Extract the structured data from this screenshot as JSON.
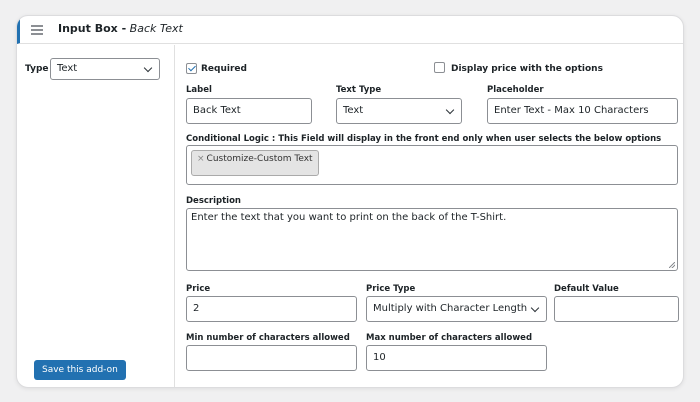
{
  "header": {
    "title_bold": "Input Box -",
    "title_italic": "Back Text"
  },
  "sidebar": {
    "type_label": "Type",
    "type_value": "Text",
    "save_label": "Save this add-on"
  },
  "form": {
    "required_label": "Required",
    "required_checked": true,
    "display_price_label": "Display price with the options",
    "display_price_checked": false,
    "label_label": "Label",
    "label_value": "Back Text",
    "text_type_label": "Text Type",
    "text_type_value": "Text",
    "placeholder_label": "Placeholder",
    "placeholder_value": "Enter Text - Max 10 Characters",
    "conditional_label": "Conditional Logic : This Field will display in the front end only when user selects the below options",
    "conditional_tag_x": "×",
    "conditional_tag": "Customize-Custom Text",
    "description_label": "Description",
    "description_value": "Enter the text that you want to print on the back of the T-Shirt.",
    "price_label": "Price",
    "price_value": "2",
    "price_type_label": "Price Type",
    "price_type_value": "Multiply with Character Length",
    "default_value_label": "Default Value",
    "default_value": "",
    "min_chars_label": "Min number of characters allowed",
    "min_chars_value": "",
    "max_chars_label": "Max number of characters allowed",
    "max_chars_value": "10"
  },
  "colors": {
    "accent": "#2271b1",
    "border": "#8c8f94"
  }
}
